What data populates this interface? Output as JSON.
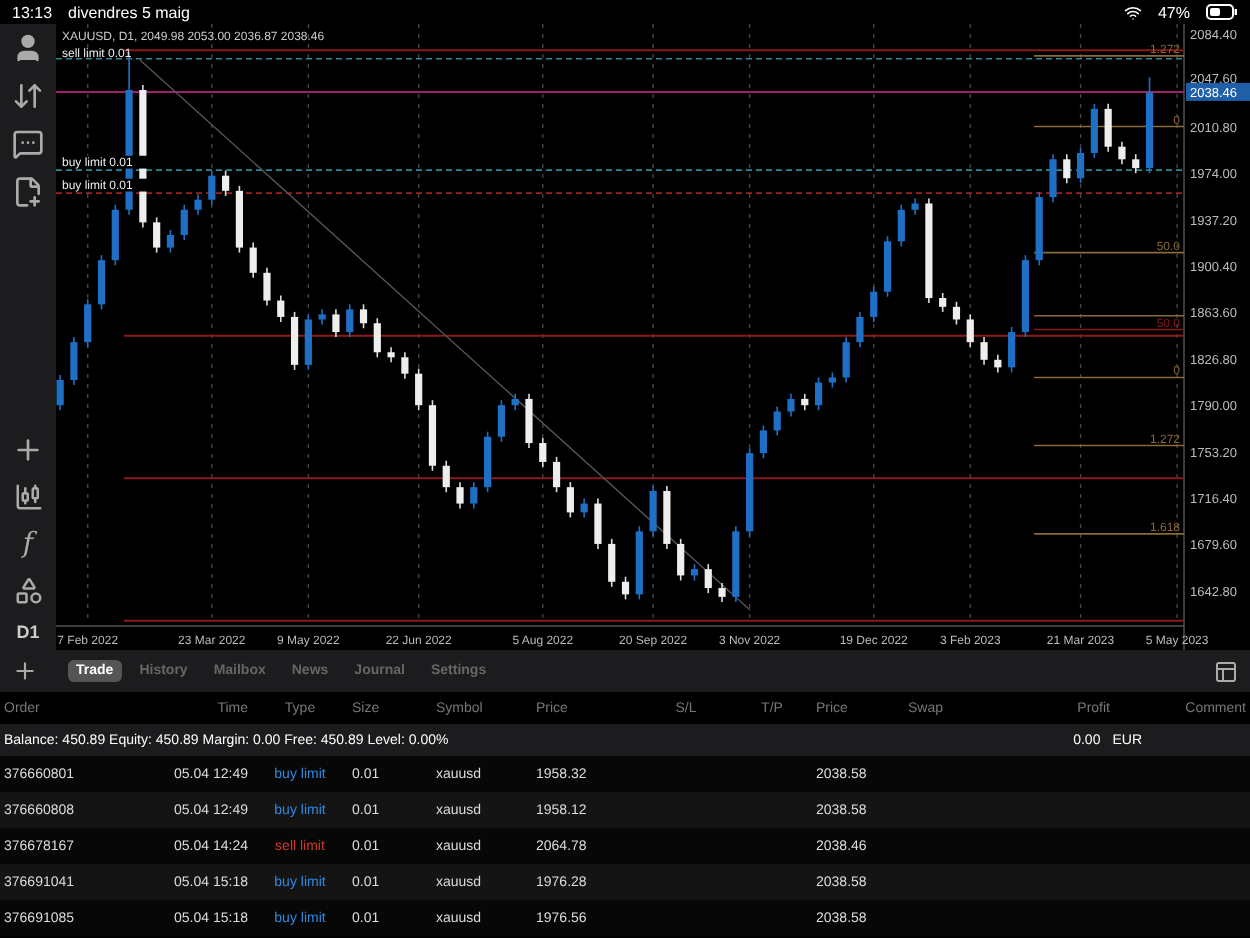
{
  "status_bar": {
    "time": "13:13",
    "date": "divendres 5 maig",
    "battery": "47%"
  },
  "sidebar": {
    "function_label": "f",
    "timeframe": "D1"
  },
  "chart": {
    "title": "XAUUSD, D1, 2049.98 2053.00 2036.87 2038.46",
    "chart_data": {
      "type": "candlestick",
      "categories": [
        null,
        null,
        "7 Feb 2022",
        null,
        null,
        null,
        null,
        null,
        null,
        null,
        null,
        "23 Mar 2022",
        null,
        null,
        null,
        null,
        null,
        null,
        "9 May 2022",
        null,
        null,
        null,
        null,
        null,
        null,
        null,
        "22 Jun 2022",
        null,
        null,
        null,
        null,
        null,
        null,
        null,
        null,
        "5 Aug 2022",
        null,
        null,
        null,
        null,
        null,
        null,
        null,
        "20 Sep 2022",
        null,
        null,
        null,
        null,
        null,
        null,
        "3 Nov 2022",
        null,
        null,
        null,
        null,
        null,
        null,
        null,
        null,
        "19 Dec 2022",
        null,
        null,
        null,
        null,
        null,
        null,
        "3 Feb 2023",
        null,
        null,
        null,
        null,
        null,
        null,
        null,
        "21 Mar 2023",
        null,
        null,
        null,
        null,
        null,
        null,
        "5 May 2023"
      ],
      "ohlc": [
        [
          1790,
          1814,
          1786,
          1810
        ],
        [
          1810,
          1844,
          1806,
          1840
        ],
        [
          1840,
          1874,
          1836,
          1870
        ],
        [
          1870,
          1909,
          1866,
          1905
        ],
        [
          1905,
          1949,
          1901,
          1945
        ],
        [
          1945,
          2070,
          1941,
          2040
        ],
        [
          2040,
          2044,
          1931,
          1935
        ],
        [
          1935,
          1939,
          1911,
          1915
        ],
        [
          1915,
          1929,
          1911,
          1925
        ],
        [
          1925,
          1949,
          1921,
          1945
        ],
        [
          1945,
          1957,
          1941,
          1953
        ],
        [
          1953,
          1976,
          1949,
          1972
        ],
        [
          1972,
          1976,
          1956,
          1960
        ],
        [
          1960,
          1964,
          1911,
          1915
        ],
        [
          1915,
          1919,
          1891,
          1895
        ],
        [
          1895,
          1899,
          1869,
          1873
        ],
        [
          1873,
          1877,
          1856,
          1860
        ],
        [
          1860,
          1864,
          1818,
          1822
        ],
        [
          1822,
          1862,
          1818,
          1858
        ],
        [
          1858,
          1866,
          1854,
          1862
        ],
        [
          1862,
          1866,
          1844,
          1848
        ],
        [
          1848,
          1870,
          1844,
          1866
        ],
        [
          1866,
          1870,
          1851,
          1855
        ],
        [
          1855,
          1859,
          1828,
          1832
        ],
        [
          1832,
          1836,
          1824,
          1828
        ],
        [
          1828,
          1832,
          1811,
          1815
        ],
        [
          1815,
          1819,
          1786,
          1790
        ],
        [
          1790,
          1794,
          1738,
          1742
        ],
        [
          1742,
          1746,
          1721,
          1725
        ],
        [
          1725,
          1729,
          1708,
          1712
        ],
        [
          1712,
          1729,
          1708,
          1725
        ],
        [
          1725,
          1769,
          1721,
          1765
        ],
        [
          1765,
          1794,
          1761,
          1790
        ],
        [
          1790,
          1799,
          1786,
          1795
        ],
        [
          1795,
          1799,
          1756,
          1760
        ],
        [
          1760,
          1764,
          1741,
          1745
        ],
        [
          1745,
          1749,
          1721,
          1725
        ],
        [
          1725,
          1729,
          1701,
          1705
        ],
        [
          1705,
          1716,
          1701,
          1712
        ],
        [
          1712,
          1716,
          1676,
          1680
        ],
        [
          1680,
          1684,
          1646,
          1650
        ],
        [
          1650,
          1654,
          1636,
          1640
        ],
        [
          1640,
          1694,
          1636,
          1690
        ],
        [
          1690,
          1726,
          1686,
          1722
        ],
        [
          1722,
          1726,
          1676,
          1680
        ],
        [
          1680,
          1684,
          1651,
          1655
        ],
        [
          1655,
          1664,
          1651,
          1660
        ],
        [
          1660,
          1664,
          1641,
          1645
        ],
        [
          1645,
          1649,
          1634,
          1638
        ],
        [
          1638,
          1694,
          1634,
          1690
        ],
        [
          1690,
          1756,
          1686,
          1752
        ],
        [
          1752,
          1774,
          1748,
          1770
        ],
        [
          1770,
          1789,
          1766,
          1785
        ],
        [
          1785,
          1799,
          1781,
          1795
        ],
        [
          1795,
          1799,
          1786,
          1790
        ],
        [
          1790,
          1812,
          1786,
          1808
        ],
        [
          1808,
          1816,
          1804,
          1812
        ],
        [
          1812,
          1844,
          1808,
          1840
        ],
        [
          1840,
          1864,
          1836,
          1860
        ],
        [
          1860,
          1884,
          1856,
          1880
        ],
        [
          1880,
          1924,
          1876,
          1920
        ],
        [
          1920,
          1949,
          1916,
          1945
        ],
        [
          1945,
          1954,
          1941,
          1950
        ],
        [
          1950,
          1954,
          1871,
          1875
        ],
        [
          1875,
          1879,
          1864,
          1868
        ],
        [
          1868,
          1872,
          1854,
          1858
        ],
        [
          1858,
          1862,
          1836,
          1840
        ],
        [
          1840,
          1844,
          1822,
          1826
        ],
        [
          1826,
          1830,
          1816,
          1820
        ],
        [
          1820,
          1852,
          1816,
          1848
        ],
        [
          1848,
          1909,
          1844,
          1905
        ],
        [
          1905,
          1959,
          1901,
          1955
        ],
        [
          1955,
          1989,
          1951,
          1985
        ],
        [
          1985,
          1989,
          1966,
          1970
        ],
        [
          1970,
          1994,
          1966,
          1990
        ],
        [
          1990,
          2029,
          1986,
          2025
        ],
        [
          2025,
          2029,
          1991,
          1995
        ],
        [
          1995,
          1999,
          1981,
          1985
        ],
        [
          1985,
          1989,
          1974,
          1978
        ],
        [
          1978,
          2050,
          1974,
          2038
        ],
        null,
        null
      ],
      "ylim": [
        1616.5,
        2092.3
      ],
      "grid": true,
      "yticks": [
        {
          "value": 2084.4,
          "label": "2084.40"
        },
        {
          "value": 2047.6,
          "label": "2047.60"
        },
        {
          "value": 2010.8,
          "label": "2010.80"
        },
        {
          "value": 1974.0,
          "label": "1974.00"
        },
        {
          "value": 1937.2,
          "label": "1937.20"
        },
        {
          "value": 1900.4,
          "label": "1900.40"
        },
        {
          "value": 1863.6,
          "label": "1863.60"
        },
        {
          "value": 1826.8,
          "label": "1826.80"
        },
        {
          "value": 1790.0,
          "label": "1790.00"
        },
        {
          "value": 1753.2,
          "label": "1753.20"
        },
        {
          "value": 1716.4,
          "label": "1716.40"
        },
        {
          "value": 1679.6,
          "label": "1679.60"
        },
        {
          "value": 1642.8,
          "label": "1642.80"
        }
      ],
      "ref_lines": [
        {
          "axis": "y",
          "value": 2071.5
        },
        {
          "axis": "y",
          "value": 2064.78,
          "label": "sell limit 0.01"
        },
        {
          "axis": "y",
          "value": 2038.46,
          "label": "2038.46"
        },
        {
          "axis": "y",
          "value": 1976.4,
          "label": "buy limit 0.01"
        },
        {
          "axis": "y",
          "value": 1958.2,
          "label": "buy limit 0.01"
        },
        {
          "axis": "y",
          "value": 1845
        },
        {
          "axis": "y",
          "value": 1732
        },
        {
          "axis": "y",
          "value": 1619
        },
        {
          "axis": "y",
          "value": 2067
        },
        {
          "axis": "y",
          "value": 2011
        },
        {
          "axis": "y",
          "value": 1911
        },
        {
          "axis": "y",
          "value": 1861
        },
        {
          "axis": "y",
          "value": 1850
        },
        {
          "axis": "y",
          "value": 1812
        },
        {
          "axis": "y",
          "value": 1758
        },
        {
          "axis": "y",
          "value": 1688
        }
      ],
      "annotations": [
        "1.272",
        "0",
        "50.0",
        "50.0",
        "0",
        "1.272",
        "1.618"
      ]
    }
  },
  "tabs": [
    {
      "label": "Trade",
      "selected": true
    },
    {
      "label": "History",
      "selected": false
    },
    {
      "label": "Mailbox",
      "selected": false
    },
    {
      "label": "News",
      "selected": false
    },
    {
      "label": "Journal",
      "selected": false
    },
    {
      "label": "Settings",
      "selected": false
    }
  ],
  "table": {
    "columns": [
      "Order",
      "Time",
      "Type",
      "Size",
      "Symbol",
      "Price",
      "S/L",
      "T/P",
      "Price",
      "Swap",
      "Profit",
      "Comment"
    ],
    "summary": {
      "text": "Balance: 450.89 Equity: 450.89 Margin: 0.00 Free: 450.89 Level: 0.00%",
      "profit": "0.00",
      "currency": "EUR"
    },
    "rows": [
      {
        "order": "376660801",
        "time": "05.04 12:49",
        "type": "buy limit",
        "kind": "buy",
        "size": "0.01",
        "symbol": "xauusd",
        "price": "1958.32",
        "current_price": "2038.58"
      },
      {
        "order": "376660808",
        "time": "05.04 12:49",
        "type": "buy limit",
        "kind": "buy",
        "size": "0.01",
        "symbol": "xauusd",
        "price": "1958.12",
        "current_price": "2038.58"
      },
      {
        "order": "376678167",
        "time": "05.04 14:24",
        "type": "sell limit",
        "kind": "sell",
        "size": "0.01",
        "symbol": "xauusd",
        "price": "2064.78",
        "current_price": "2038.46"
      },
      {
        "order": "376691041",
        "time": "05.04 15:18",
        "type": "buy limit",
        "kind": "buy",
        "size": "0.01",
        "symbol": "xauusd",
        "price": "1976.28",
        "current_price": "2038.58"
      },
      {
        "order": "376691085",
        "time": "05.04 15:18",
        "type": "buy limit",
        "kind": "buy",
        "size": "0.01",
        "symbol": "xauusd",
        "price": "1976.56",
        "current_price": "2038.58"
      }
    ]
  }
}
